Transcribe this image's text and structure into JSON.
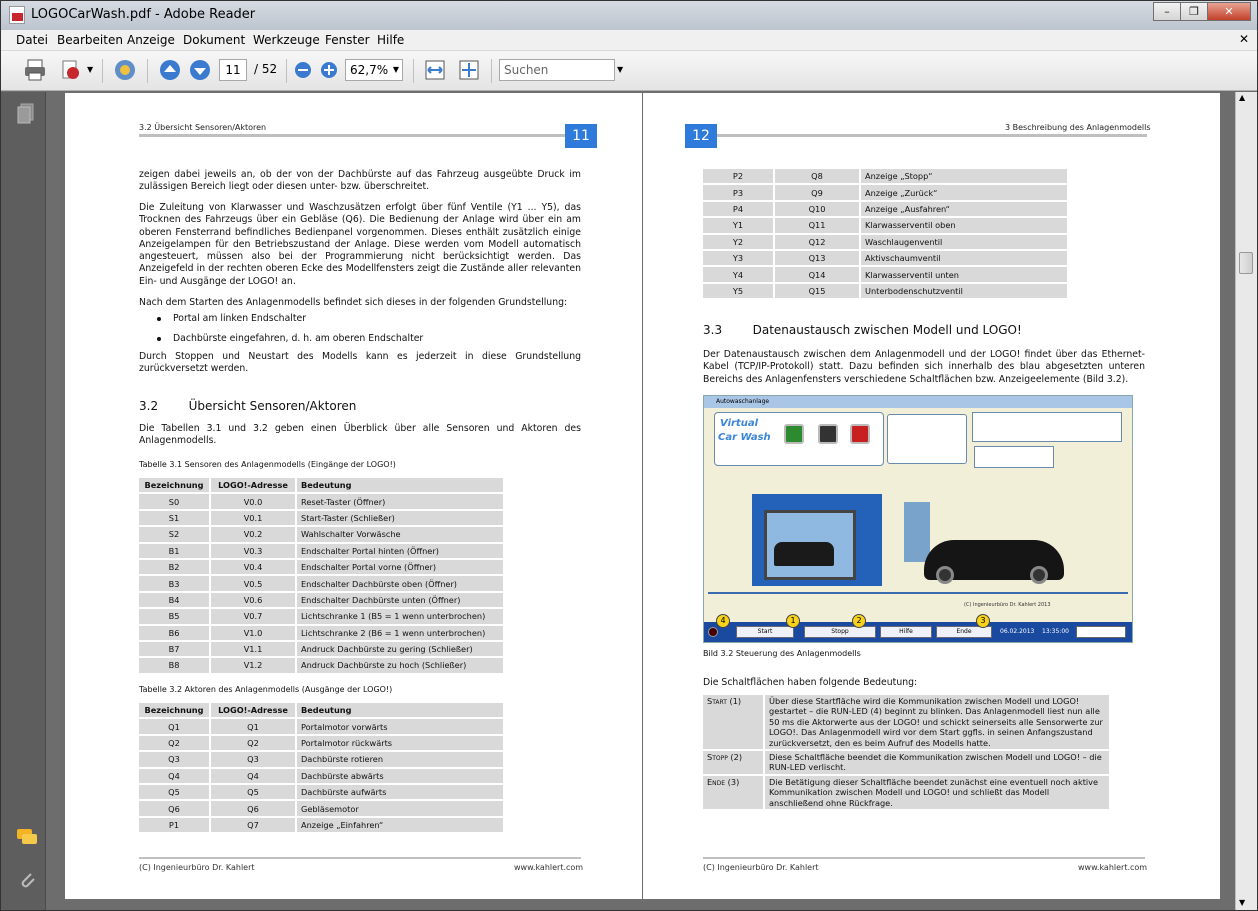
{
  "window": {
    "title": "LOGOCarWash.pdf - Adobe Reader"
  },
  "menu": [
    "Datei",
    "Bearbeiten",
    "Anzeige",
    "Dokument",
    "Werkzeuge",
    "Fenster",
    "Hilfe"
  ],
  "toolbar": {
    "page_current": "11",
    "page_total": "/ 52",
    "zoom": "62,7%",
    "search_placeholder": "Suchen"
  },
  "page1": {
    "header_section": "3.2 Übersicht Sensoren/Aktoren",
    "page_number": "11",
    "para1": "zeigen dabei jeweils an, ob der von der Dachbürste auf das Fahrzeug ausgeübte Druck im zulässigen Bereich liegt oder diesen unter- bzw. überschreitet.",
    "para2": "Die Zuleitung von Klarwasser und Waschzusätzen erfolgt über fünf Ventile (Y1 ... Y5), das Trocknen des Fahrzeugs über ein Gebläse (Q6). Die Bedienung der Anlage wird über ein am oberen Fensterrand befindliches Bedienpanel vorgenommen. Dieses enthält zusätzlich einige Anzeigelampen für den Betriebszustand der Anlage. Diese werden vom Modell automatisch angesteuert, müssen also bei der Programmierung nicht berücksichtigt werden. Das Anzeigefeld in der rechten oberen Ecke des Modellfensters zeigt die Zustände aller relevanten Ein- und Ausgänge der LOGO! an.",
    "para3": "Nach dem Starten des Anlagenmodells befindet sich dieses in der folgenden Grundstellung:",
    "bullet1": "Portal am linken Endschalter",
    "bullet2": "Dachbürste eingefahren, d. h. am oberen Endschalter",
    "para4": "Durch Stoppen und Neustart des Modells kann es jederzeit in diese Grundstellung zurückversetzt werden.",
    "section_title": "3.2        Übersicht Sensoren/Aktoren",
    "para5": "Die Tabellen 3.1 und 3.2 geben einen Überblick über alle Sensoren und Aktoren des Anlagenmodells.",
    "table1_caption": "Tabelle 3.1  Sensoren des Anlagenmodells (Eingänge der LOGO!)",
    "table_headers": [
      "Bezeichnung",
      "LOGO!-Adresse",
      "Bedeutung"
    ],
    "table1": [
      [
        "S0",
        "V0.0",
        "Reset-Taster (Öffner)"
      ],
      [
        "S1",
        "V0.1",
        "Start-Taster (Schließer)"
      ],
      [
        "S2",
        "V0.2",
        "Wahlschalter Vorwäsche"
      ],
      [
        "B1",
        "V0.3",
        "Endschalter Portal hinten (Öffner)"
      ],
      [
        "B2",
        "V0.4",
        "Endschalter Portal vorne (Öffner)"
      ],
      [
        "B3",
        "V0.5",
        "Endschalter Dachbürste oben (Öffner)"
      ],
      [
        "B4",
        "V0.6",
        "Endschalter Dachbürste unten (Öffner)"
      ],
      [
        "B5",
        "V0.7",
        "Lichtschranke 1 (B5 = 1 wenn unterbrochen)"
      ],
      [
        "B6",
        "V1.0",
        "Lichtschranke 2 (B6 = 1 wenn unterbrochen)"
      ],
      [
        "B7",
        "V1.1",
        "Andruck Dachbürste zu gering (Schließer)"
      ],
      [
        "B8",
        "V1.2",
        "Andruck Dachbürste zu hoch (Schließer)"
      ]
    ],
    "table2_caption": "Tabelle 3.2  Aktoren des Anlagenmodells (Ausgänge der LOGO!)",
    "table2": [
      [
        "Q1",
        "Q1",
        "Portalmotor vorwärts"
      ],
      [
        "Q2",
        "Q2",
        "Portalmotor rückwärts"
      ],
      [
        "Q3",
        "Q3",
        "Dachbürste rotieren"
      ],
      [
        "Q4",
        "Q4",
        "Dachbürste abwärts"
      ],
      [
        "Q5",
        "Q5",
        "Dachbürste aufwärts"
      ],
      [
        "Q6",
        "Q6",
        "Gebläsemotor"
      ],
      [
        "P1",
        "Q7",
        "Anzeige „Einfahren“"
      ]
    ],
    "footer_left": "(C) Ingenieurbüro Dr. Kahlert",
    "footer_right": "www.kahlert.com"
  },
  "page2": {
    "page_number": "12",
    "header_section": "3  Beschreibung des Anlagenmodells",
    "table_cont": [
      [
        "P2",
        "Q8",
        "Anzeige „Stopp“"
      ],
      [
        "P3",
        "Q9",
        "Anzeige „Zurück“"
      ],
      [
        "P4",
        "Q10",
        "Anzeige „Ausfahren“"
      ],
      [
        "Y1",
        "Q11",
        "Klarwasserventil oben"
      ],
      [
        "Y2",
        "Q12",
        "Waschlaugenventil"
      ],
      [
        "Y3",
        "Q13",
        "Aktivschaumventil"
      ],
      [
        "Y4",
        "Q14",
        "Klarwasserventil unten"
      ],
      [
        "Y5",
        "Q15",
        "Unterbodenschutzventil"
      ]
    ],
    "section_title": "3.3        Datenaustausch zwischen Modell und LOGO!",
    "para1": "Der Datenaustausch zwischen dem Anlagenmodell und der LOGO! findet über das Ethernet-Kabel (TCP/IP-Protokoll) statt. Dazu befinden sich innerhalb des blau abgesetzten unteren Bereichs des Anlagenfensters verschiedene Schaltflächen bzw. Anzeigeelemente (Bild 3.2).",
    "figure": {
      "window_title": "Autowaschanlage",
      "logo_line1": "Virtual",
      "logo_line2": "Car Wash",
      "btn_start": "Start",
      "btn_stopp": "Stopp",
      "btn_hilfe": "Hilfe",
      "btn_ende": "Ende",
      "date": "06.02.2013",
      "time": "13:35:00",
      "copyright": "(C) Ingenieurbüro Dr. Kahlert 2013",
      "callouts": [
        "1",
        "2",
        "3",
        "4"
      ]
    },
    "figure_caption": "Bild 3.2  Steuerung des Anlagenmodells",
    "para2": "Die Schaltflächen haben folgende Bedeutung:",
    "buttons_table": [
      [
        "Start (1)",
        "Über diese Startfläche wird die Kommunikation zwischen Modell und LOGO! gestartet – die RUN-LED (4) beginnt zu blinken. Das Anlagenmodell liest nun alle 50 ms die Aktorwerte aus der LOGO! und schickt seinerseits alle Sensorwerte zur LOGO!. Das Anlagenmodell wird vor dem Start ggfls. in seinen Anfangszustand zurückversetzt, den es beim Aufruf des Modells hatte."
      ],
      [
        "Stopp (2)",
        "Diese Schaltfläche beendet die Kommunikation zwischen Modell und LOGO! – die RUN-LED verlischt."
      ],
      [
        "Ende (3)",
        "Die Betätigung dieser Schaltfläche beendet zunächst eine eventuell noch aktive Kommunikation zwischen Modell und LOGO! und schließt das Modell anschließend ohne Rückfrage."
      ]
    ],
    "footer_left": "(C) Ingenieurbüro Dr. Kahlert",
    "footer_right": "www.kahlert.com"
  }
}
